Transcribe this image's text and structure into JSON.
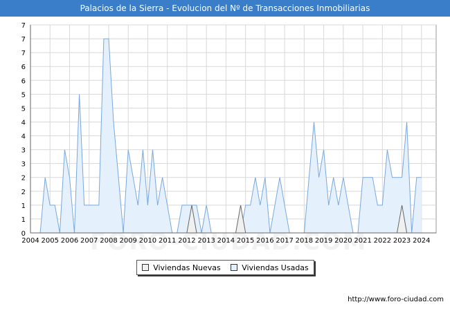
{
  "chart_data": {
    "type": "area",
    "title": "Palacios de la Sierra - Evolucion del Nº de Transacciones Inmobiliarias",
    "xlabel": "",
    "ylabel": "",
    "x_ticks": [
      "2004",
      "2005",
      "2006",
      "2007",
      "2008",
      "2009",
      "2010",
      "2011",
      "2012",
      "2013",
      "2014",
      "2015",
      "2016",
      "2017",
      "2018",
      "2019",
      "2020",
      "2021",
      "2022",
      "2023",
      "2024"
    ],
    "y_ticks": [
      "0",
      "1",
      "1",
      "2",
      "2",
      "3",
      "3",
      "4",
      "4",
      "5",
      "5",
      "6",
      "6",
      "7",
      "7",
      "7"
    ],
    "ylim": [
      0,
      7.5
    ],
    "xlim": [
      2004,
      2024.75
    ],
    "grid": true,
    "legend_position": "bottom-center",
    "series": [
      {
        "name": "Viviendas Nuevas",
        "color": "#f0f0f0",
        "stroke": "#666666",
        "values": [
          [
            2012.0,
            0
          ],
          [
            2012.25,
            1
          ],
          [
            2012.5,
            0
          ],
          [
            2014.5,
            0
          ],
          [
            2014.75,
            1
          ],
          [
            2015.0,
            0
          ],
          [
            2022.75,
            0
          ],
          [
            2023.0,
            1
          ],
          [
            2023.25,
            0
          ]
        ]
      },
      {
        "name": "Viviendas Usadas",
        "color": "#e4f0fc",
        "stroke": "#7aa8de",
        "values": [
          [
            2004.0,
            0
          ],
          [
            2004.25,
            0
          ],
          [
            2004.5,
            0
          ],
          [
            2004.75,
            2
          ],
          [
            2005.0,
            1
          ],
          [
            2005.25,
            1
          ],
          [
            2005.5,
            0
          ],
          [
            2005.75,
            3
          ],
          [
            2006.0,
            2
          ],
          [
            2006.25,
            0
          ],
          [
            2006.5,
            5
          ],
          [
            2006.75,
            1
          ],
          [
            2007.0,
            1
          ],
          [
            2007.25,
            1
          ],
          [
            2007.5,
            1
          ],
          [
            2007.75,
            7
          ],
          [
            2008.0,
            7
          ],
          [
            2008.25,
            4
          ],
          [
            2008.5,
            2
          ],
          [
            2008.75,
            0
          ],
          [
            2009.0,
            3
          ],
          [
            2009.25,
            2
          ],
          [
            2009.5,
            1
          ],
          [
            2009.75,
            3
          ],
          [
            2010.0,
            1
          ],
          [
            2010.25,
            3
          ],
          [
            2010.5,
            1
          ],
          [
            2010.75,
            2
          ],
          [
            2011.0,
            1
          ],
          [
            2011.25,
            0
          ],
          [
            2011.5,
            0
          ],
          [
            2011.75,
            1
          ],
          [
            2012.0,
            1
          ],
          [
            2012.25,
            1
          ],
          [
            2012.5,
            1
          ],
          [
            2012.75,
            0
          ],
          [
            2013.0,
            1
          ],
          [
            2013.25,
            0
          ],
          [
            2013.5,
            0
          ],
          [
            2013.75,
            0
          ],
          [
            2014.0,
            0
          ],
          [
            2014.25,
            0
          ],
          [
            2014.5,
            0
          ],
          [
            2014.75,
            0
          ],
          [
            2015.0,
            1
          ],
          [
            2015.25,
            1
          ],
          [
            2015.5,
            2
          ],
          [
            2015.75,
            1
          ],
          [
            2016.0,
            2
          ],
          [
            2016.25,
            0
          ],
          [
            2016.5,
            1
          ],
          [
            2016.75,
            2
          ],
          [
            2017.0,
            1
          ],
          [
            2017.25,
            0
          ],
          [
            2017.5,
            0
          ],
          [
            2017.75,
            0
          ],
          [
            2018.0,
            0
          ],
          [
            2018.25,
            2
          ],
          [
            2018.5,
            4
          ],
          [
            2018.75,
            2
          ],
          [
            2019.0,
            3
          ],
          [
            2019.25,
            1
          ],
          [
            2019.5,
            2
          ],
          [
            2019.75,
            1
          ],
          [
            2020.0,
            2
          ],
          [
            2020.25,
            1
          ],
          [
            2020.5,
            0
          ],
          [
            2020.75,
            0
          ],
          [
            2021.0,
            2
          ],
          [
            2021.25,
            2
          ],
          [
            2021.5,
            2
          ],
          [
            2021.75,
            1
          ],
          [
            2022.0,
            1
          ],
          [
            2022.25,
            3
          ],
          [
            2022.5,
            2
          ],
          [
            2022.75,
            2
          ],
          [
            2023.0,
            2
          ],
          [
            2023.25,
            4
          ],
          [
            2023.5,
            0
          ],
          [
            2023.75,
            2
          ],
          [
            2024.0,
            2
          ]
        ]
      }
    ]
  },
  "legend": {
    "items": [
      "Viviendas Nuevas",
      "Viviendas Usadas"
    ]
  },
  "footer": {
    "url": "http://www.foro-ciudad.com"
  },
  "watermark": "FORO-CIUDAD.COM"
}
